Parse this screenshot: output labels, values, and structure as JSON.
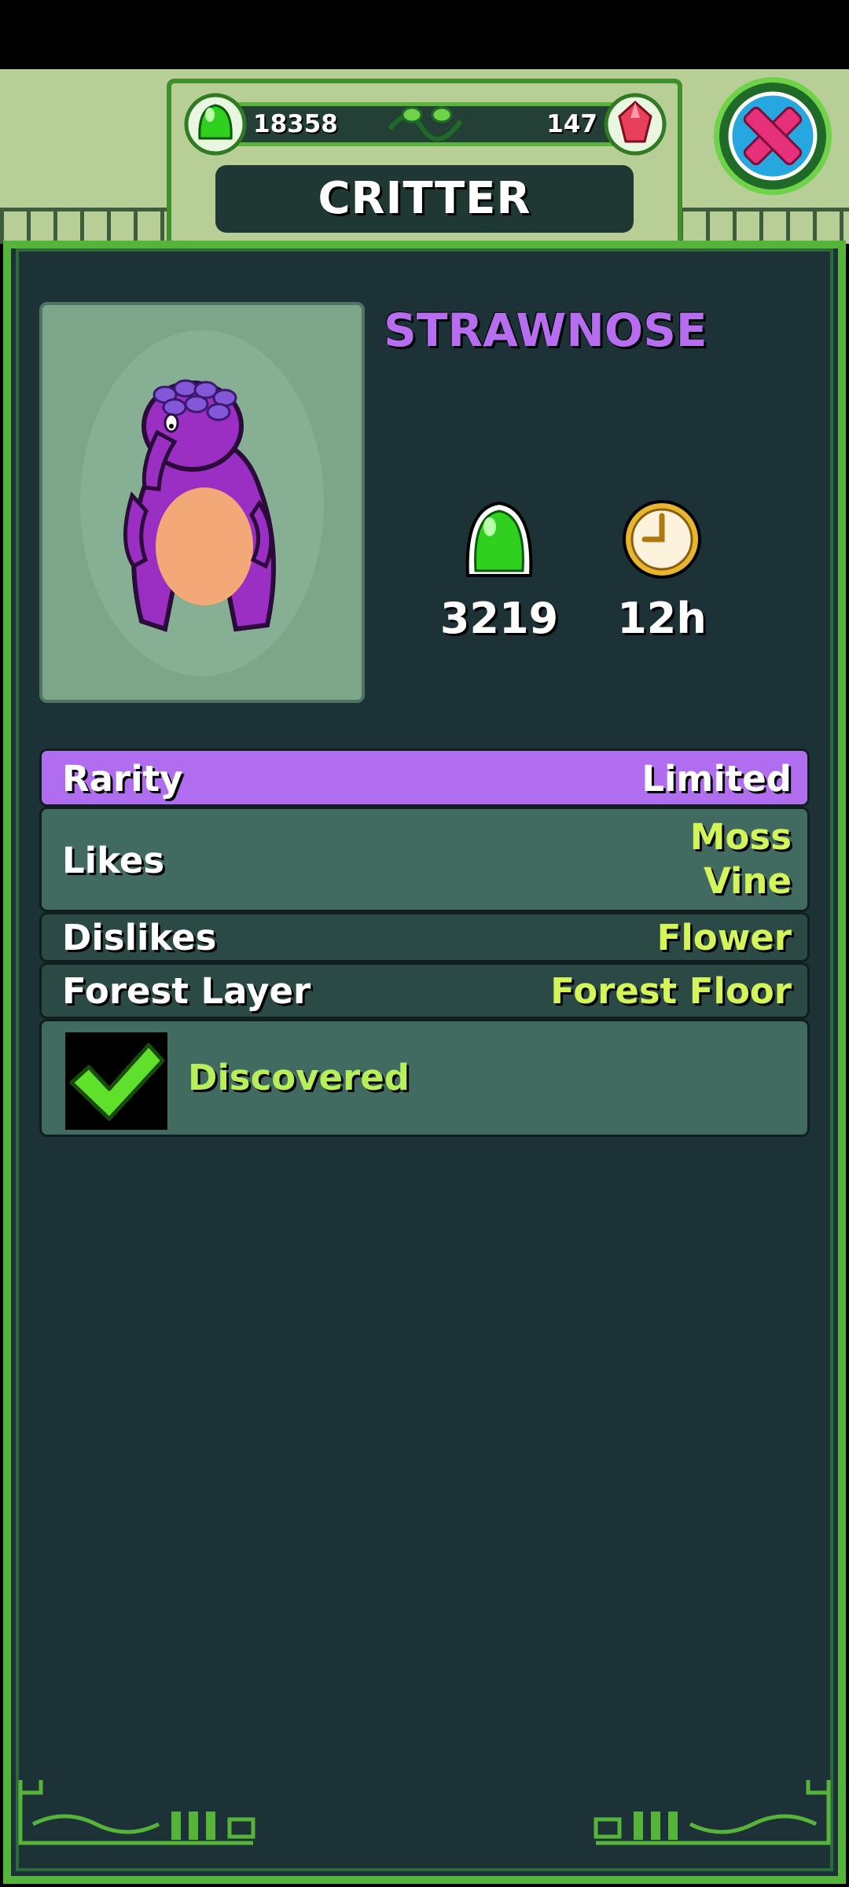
{
  "header": {
    "title": "CRITTER",
    "jelly_count": "18358",
    "gem_count": "147"
  },
  "critter": {
    "name": "STRAWNOSE",
    "jelly_value": "3219",
    "time_value": "12h"
  },
  "info_rows": {
    "rarity": {
      "label": "Rarity",
      "value": "Limited"
    },
    "likes": {
      "label": "Likes",
      "values": [
        "Moss",
        "Vine"
      ]
    },
    "dislikes": {
      "label": "Dislikes",
      "value": "Flower"
    },
    "forest_layer": {
      "label": "Forest Layer",
      "value": "Forest Floor"
    }
  },
  "status": {
    "discovered_label": "Discovered"
  },
  "icons": {
    "jelly": "green-jelly-icon",
    "gem": "red-gem-icon",
    "clock": "clock-icon",
    "close": "close-x-icon",
    "check": "checkmark-icon"
  },
  "colors": {
    "panel": "#1c3237",
    "rarity_purple": "#b06df0",
    "accent_green": "#56b43a",
    "value_yellow_green": "#d4f55a"
  }
}
